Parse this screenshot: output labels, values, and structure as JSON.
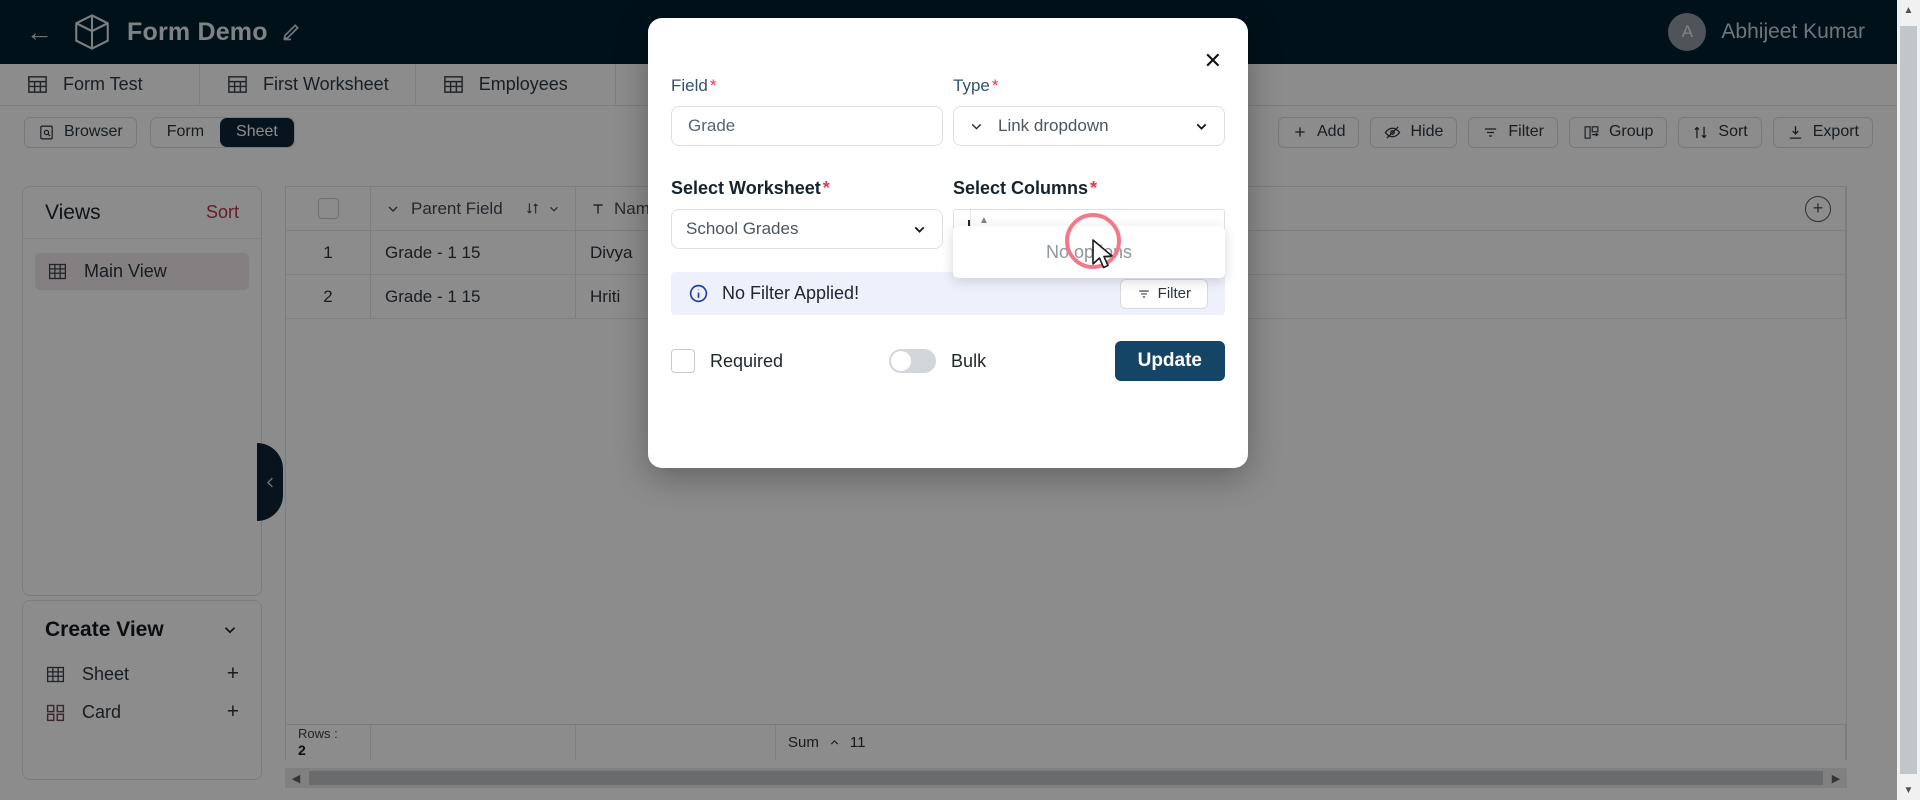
{
  "topbar": {
    "back_icon": "back-arrow-icon",
    "logo_icon": "cube-logo-icon",
    "title": "Form Demo",
    "edit_icon": "pencil-icon",
    "avatar_initial": "A",
    "user_name": "Abhijeet Kumar",
    "background": "#032030"
  },
  "worksheet_tabs": [
    {
      "label": "Form Test",
      "icon": "table-grid-icon"
    },
    {
      "label": "First Worksheet",
      "icon": "table-grid-icon"
    },
    {
      "label": "Employees",
      "icon": "table-grid-icon"
    }
  ],
  "viewbar": {
    "browser_label": "Browser",
    "browser_icon": "browser-icon",
    "segments": [
      {
        "label": "Form",
        "active": false
      },
      {
        "label": "Sheet",
        "active": true
      }
    ],
    "actions": [
      {
        "label": "Add",
        "icon": "plus-icon"
      },
      {
        "label": "Hide",
        "icon": "eye-off-icon"
      },
      {
        "label": "Filter",
        "icon": "filter-icon"
      },
      {
        "label": "Group",
        "icon": "group-icon"
      },
      {
        "label": "Sort",
        "icon": "sort-icon"
      },
      {
        "label": "Export",
        "icon": "download-icon"
      }
    ]
  },
  "views_panel": {
    "title": "Views",
    "sort_label": "Sort",
    "items": [
      {
        "label": "Main View",
        "icon": "table-grid-icon"
      }
    ]
  },
  "create_panel": {
    "title": "Create View",
    "chevron_icon": "chevron-down-icon",
    "items": [
      {
        "label": "Sheet",
        "icon": "table-grid-icon",
        "add": "+"
      },
      {
        "label": "Card",
        "icon": "card-grid-icon",
        "add": "+"
      }
    ]
  },
  "collapse_handle": {
    "icon": "chevron-left-icon"
  },
  "grid": {
    "columns": [
      {
        "key": "check",
        "label": "",
        "icon": "checkbox-icon"
      },
      {
        "key": "parent",
        "label": "Parent Field",
        "icon": "chevron-down-icon",
        "sort_icon": "sort-updown-icon"
      },
      {
        "key": "name",
        "label": "Name",
        "icon": "text-type-icon"
      },
      {
        "key": "rest",
        "label": "",
        "icon": "add-column-icon"
      }
    ],
    "rows": [
      {
        "num": "1",
        "parent": "Grade - 1 15",
        "name": "Divya"
      },
      {
        "num": "2",
        "parent": "Grade - 1 15",
        "name": "Hriti"
      }
    ]
  },
  "footer": {
    "rows_label": "Rows :",
    "rows_value": "2",
    "sum_label": "Sum",
    "sum_caret": "caret-up-icon",
    "sum_value": "11"
  },
  "modal": {
    "close_icon": "close-icon",
    "field": {
      "label": "Field",
      "required": "*",
      "value": "Grade",
      "placeholder": "Grade"
    },
    "type": {
      "label": "Type",
      "required": "*",
      "value": "Link dropdown",
      "left_icon": "chevron-down-icon",
      "right_icon": "chevron-down-icon"
    },
    "worksheet": {
      "label": "Select Worksheet",
      "required": "*",
      "value": "School Grades",
      "icon": "chevron-down-icon"
    },
    "columns": {
      "label": "Select Columns",
      "required": "*",
      "value": "",
      "dropdown_empty_text": "No options",
      "up_icon": "caret-up-icon",
      "down_icon": "caret-down-icon"
    },
    "alert": {
      "icon": "info-icon",
      "text": "No Filter Applied!",
      "button_label": "Filter",
      "button_icon": "filter-icon"
    },
    "required_checkbox": {
      "label": "Required",
      "checked": false
    },
    "bulk_toggle": {
      "label": "Bulk",
      "on": false
    },
    "update_button": {
      "label": "Update",
      "color": "#144566"
    }
  },
  "cursor": {
    "icon": "mouse-pointer-icon",
    "ring_color": "#f4788a"
  },
  "scrollbars": {
    "vertical": {
      "up_icon": "caret-up-icon",
      "down_icon": "caret-down-icon"
    },
    "horizontal": {
      "left_icon": "caret-left-icon",
      "right_icon": "caret-right-icon"
    }
  }
}
